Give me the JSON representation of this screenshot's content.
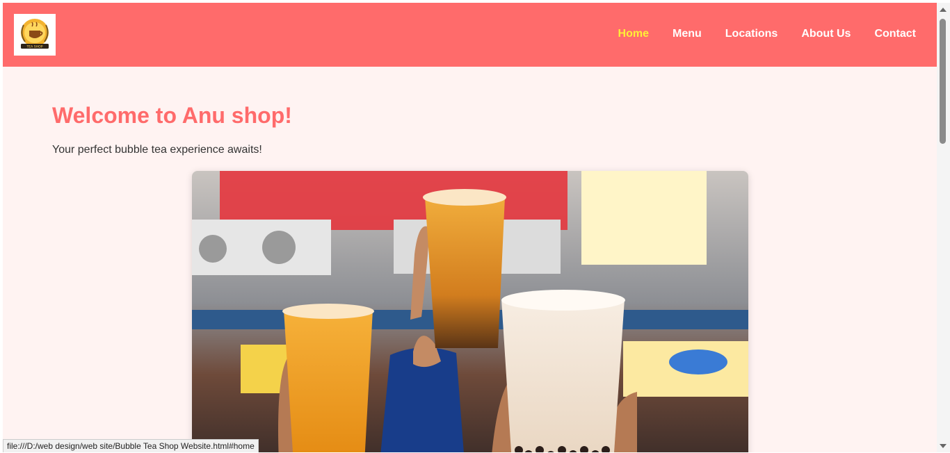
{
  "header": {
    "logo_icon": "tea-shop-logo",
    "nav": [
      {
        "label": "Home",
        "active": true
      },
      {
        "label": "Menu",
        "active": false
      },
      {
        "label": "Locations",
        "active": false
      },
      {
        "label": "About Us",
        "active": false
      },
      {
        "label": "Contact",
        "active": false
      }
    ]
  },
  "main": {
    "title": "Welcome to Anu shop!",
    "subtitle": "Your perfect bubble tea experience awaits!",
    "hero_image": "bubble-tea-cups-photo"
  },
  "statusbar": {
    "url": "file:///D:/web design/web site/Bubble Tea Shop Website.html#home"
  },
  "colors": {
    "header_bg": "#ff6b6b",
    "active_nav": "#ffee37",
    "page_bg": "#fff3f2",
    "title": "#ff6b6b"
  }
}
